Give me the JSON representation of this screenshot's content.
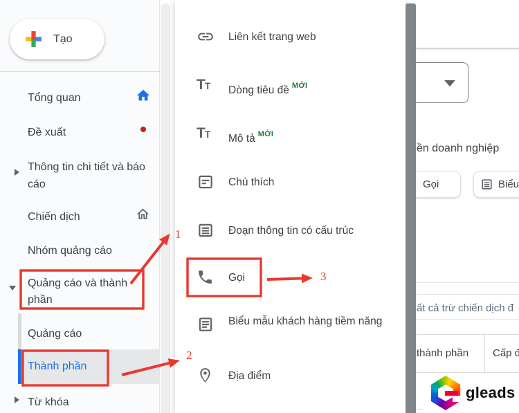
{
  "colors": {
    "annotation_red": "#e8392e",
    "selected_blue": "#1a73e8",
    "badge_green": "#188038",
    "text_primary": "#3c4043",
    "icon_gray": "#5f6368",
    "scrollbar_dark": "#7e868c",
    "notification_red": "#c5221f"
  },
  "sidebar": {
    "create_button": {
      "label": "Tạo",
      "icon": "google-plus-icon"
    },
    "items": [
      {
        "label": "Tổng quan",
        "trailing_icon": "home-icon-blue"
      },
      {
        "label": "Đề xuất",
        "trailing_icon": "red-notification-dot"
      },
      {
        "label": "Thông tin chi tiết và báo cáo",
        "leading_icon": "expand-arrow-right"
      },
      {
        "label": "Chiến dịch",
        "trailing_icon": "home-icon-gray"
      },
      {
        "label": "Nhóm quảng cáo"
      },
      {
        "label": "Quảng cáo và thành phần",
        "leading_icon": "collapse-arrow-down",
        "expanded": true
      },
      {
        "label": "Quảng cáo",
        "child": true
      },
      {
        "label": "Thành phần",
        "child": true,
        "selected": true
      },
      {
        "label": "Từ khóa",
        "leading_icon": "expand-arrow-right"
      }
    ]
  },
  "menu": {
    "items": [
      {
        "label": "Liên kết trang web",
        "icon": "link-icon"
      },
      {
        "label": "Dòng tiêu đề",
        "icon": "text-format-icon",
        "badge": "MỚI"
      },
      {
        "label": "Mô tả",
        "icon": "text-format-icon",
        "badge": "MỚI"
      },
      {
        "label": "Chú thích",
        "icon": "note-icon"
      },
      {
        "label": "Đoạn thông tin có cấu trúc",
        "icon": "snippet-icon"
      },
      {
        "label": "Gọi",
        "icon": "phone-icon"
      },
      {
        "label": "Biểu mẫu khách hàng tiềm năng",
        "icon": "form-icon"
      },
      {
        "label": "Địa điểm",
        "icon": "location-pin-icon"
      }
    ]
  },
  "content": {
    "business_name_text": "ền doanh nghiệp",
    "select_box": {
      "icon": "dropdown-arrow"
    },
    "chips": [
      {
        "label": "Gọi",
        "icon": "phone-icon"
      },
      {
        "label": "Biểu",
        "icon": "form-icon"
      }
    ],
    "filter_text": "ất cả trừ chiến dịch đ",
    "table": {
      "columns": [
        "thành phần",
        "Cấp đ"
      ]
    }
  },
  "watermark": {
    "brand": "gleads",
    "icon": "gleads-hexagon-logo"
  },
  "annotations": {
    "labels": [
      "1",
      "2",
      "3"
    ]
  }
}
